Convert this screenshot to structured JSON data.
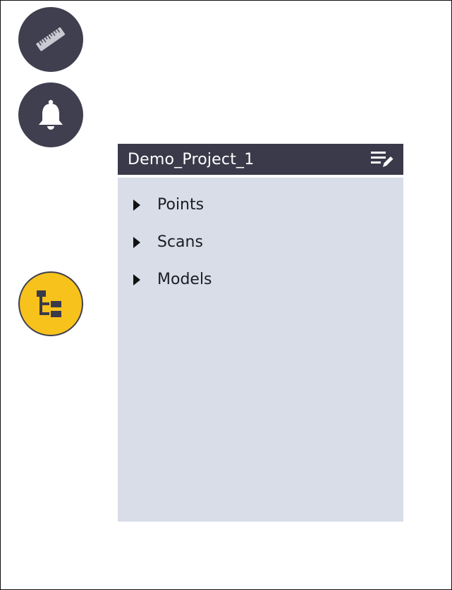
{
  "colors": {
    "fab_dark": "#3f3f4f",
    "fab_active": "#f8c21c",
    "panel_header": "#3a3a4a",
    "panel_body": "#d9dde8"
  },
  "fabs": [
    {
      "id": "measure",
      "icon": "ruler-icon"
    },
    {
      "id": "notify",
      "icon": "bell-icon"
    },
    {
      "id": "tree",
      "icon": "hierarchy-tree-icon",
      "active": true
    }
  ],
  "panel": {
    "title": "Demo_Project_1",
    "header_icon": "edit-list-icon",
    "items": [
      {
        "label": "Points",
        "icon": "caret-right-icon"
      },
      {
        "label": "Scans",
        "icon": "caret-right-icon"
      },
      {
        "label": "Models",
        "icon": "caret-right-icon"
      }
    ]
  }
}
